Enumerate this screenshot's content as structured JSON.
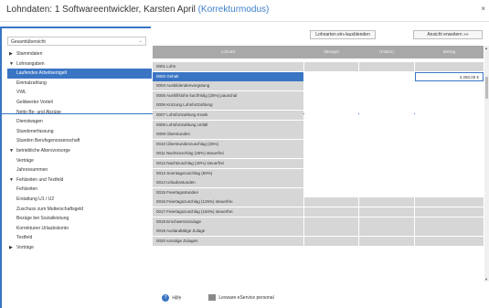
{
  "window": {
    "title_prefix": "Lohndaten: 1  Softwareentwickler, Karsten April",
    "mode": "(Korrekturmodus)",
    "close_glyph": "×"
  },
  "sidebar": {
    "view_select": "Gesamtübersicht",
    "items": [
      {
        "label": "Stammdaten",
        "caret": "▶",
        "level": 0
      },
      {
        "label": "Lohnangaben",
        "caret": "▼",
        "level": 0
      },
      {
        "label": "Laufendes Arbeitsentgelt",
        "caret": "",
        "level": 1,
        "active": true
      },
      {
        "label": "Einmalzahlung",
        "caret": "",
        "level": 1
      },
      {
        "label": "VWL",
        "caret": "",
        "level": 1
      },
      {
        "label": "Geldwerter Vorteil",
        "caret": "",
        "level": 1
      },
      {
        "label": "Netto Be- und Abzüge",
        "caret": "",
        "level": 1
      },
      {
        "label": "Dienstwagen",
        "caret": "",
        "level": 1
      },
      {
        "label": "Stundenerfassung",
        "caret": "",
        "level": 1
      },
      {
        "label": "Stunden Berufsgenossenschaft",
        "caret": "",
        "level": 1
      },
      {
        "label": "betriebliche Altersvorsorge",
        "caret": "▼",
        "level": 0
      },
      {
        "label": "Verträge",
        "caret": "",
        "level": 1
      },
      {
        "label": "Jahressummen",
        "caret": "",
        "level": 1
      },
      {
        "label": "Fehlzeiten und Textfeld",
        "caret": "▼",
        "level": 0
      },
      {
        "label": "Fehlzeiten",
        "caret": "",
        "level": 1
      },
      {
        "label": "Erstattung U1 / U2",
        "caret": "",
        "level": 1
      },
      {
        "label": "Zuschuss zum Mutterschaftsgeld",
        "caret": "",
        "level": 1
      },
      {
        "label": "Bezüge bei Sozialleistung",
        "caret": "",
        "level": 1
      },
      {
        "label": "Korrekturen Urlaubskonto",
        "caret": "",
        "level": 1
      },
      {
        "label": "Textfeld",
        "caret": "",
        "level": 1
      },
      {
        "label": "Vorträge",
        "caret": "▶",
        "level": 0
      }
    ]
  },
  "toolbar": {
    "toggle_lohnarten": "Lohnarten ein-/ausblenden",
    "expand_view": "Ansicht erweitern »»"
  },
  "grid": {
    "columns": [
      "Lohnart",
      "(Menge)",
      "(Faktor)",
      "Betrag"
    ],
    "rows": [
      {
        "lohnart": "0001 Lohn",
        "betrag": "",
        "white_menge": false,
        "white_faktor": false,
        "white_betrag": false
      },
      {
        "lohnart": "0002 Gehalt",
        "betrag": "3.250,00 €",
        "selected": true
      },
      {
        "lohnart": "0003 Ausbildendenvergütung",
        "betrag": ""
      },
      {
        "lohnart": "0005 Aushilfslohn kurzfristig (25%) pauschal",
        "betrag": ""
      },
      {
        "lohnart": "0006 Kürzung Lohnfortzahlung",
        "betrag": ""
      },
      {
        "lohnart": "0007 Lohnfortzahlung Krank",
        "betrag": ""
      },
      {
        "lohnart": "0008 Lohnfortzahlung Unfall",
        "betrag": ""
      },
      {
        "lohnart": "0009 Überstunden",
        "betrag": ""
      },
      {
        "lohnart": "0010 Überstundenzuschlag (25%)",
        "betrag": ""
      },
      {
        "lohnart": "0011 Nachtzuschlag (25%) steuerfrei",
        "betrag": ""
      },
      {
        "lohnart": "0012 Nachtzuschlag (40%) steuerfrei",
        "betrag": ""
      },
      {
        "lohnart": "0013 Sonntagszuschlag (50%)",
        "betrag": ""
      },
      {
        "lohnart": "0014 Urlaubsstunden",
        "betrag": ""
      },
      {
        "lohnart": "0015 Feiertagsstunden",
        "betrag": ""
      },
      {
        "lohnart": "0016 Feiertagszuschlag (125%) steuerfrei",
        "betrag": ""
      },
      {
        "lohnart": "0017 Feiertagszuschlag (150%) steuerfrei",
        "betrag": ""
      },
      {
        "lohnart": "0018 Erschwerniszulage",
        "betrag": ""
      },
      {
        "lohnart": "0019 Auslandtätige Zulage",
        "betrag": ""
      },
      {
        "lohnart": "0020 sonstige Zulagen",
        "betrag": ""
      }
    ]
  },
  "footer": {
    "help": "Hilfe",
    "help_icon": "?",
    "lexware": "Lexware eService personal"
  },
  "scroll": {
    "up": "▲",
    "down": "▼"
  },
  "colors": {
    "accent": "#3a75c4",
    "mode_text": "#3d7fc9"
  }
}
